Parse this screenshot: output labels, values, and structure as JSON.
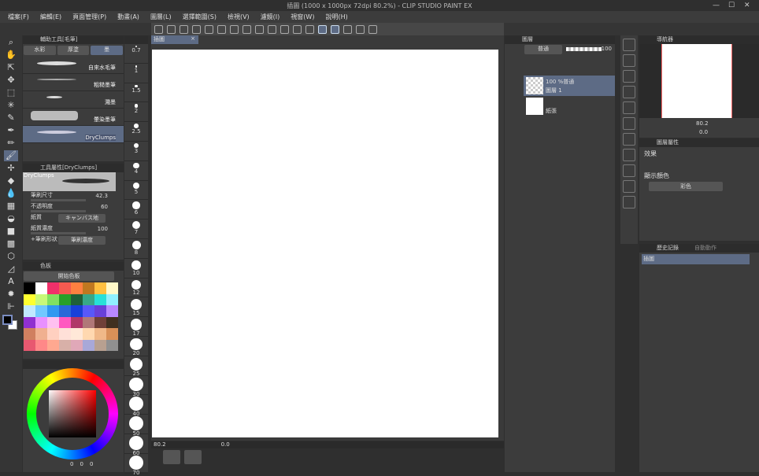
{
  "window": {
    "title": "插圖 (1000 x 1000px 72dpi 80.2%) - CLIP STUDIO PAINT EX",
    "minimize": "—",
    "maximize": "☐",
    "close": "✕"
  },
  "menu": [
    "檔案(F)",
    "編輯(E)",
    "頁面管理(P)",
    "動畫(A)",
    "圖層(L)",
    "選擇範圍(S)",
    "檢視(V)",
    "濾鏡(I)",
    "視窗(W)",
    "說明(H)"
  ],
  "subtool": {
    "title": "輔助工具[毛筆]",
    "tabs": [
      "水彩",
      "厚塗",
      "墨"
    ],
    "brushes": [
      "自來水毛筆",
      "粗糙墨筆",
      "濺墨",
      "暈染墨筆",
      "DryClumps"
    ]
  },
  "tool_property": {
    "title": "工具屬性[DryClumps]",
    "preview_label": "DryClumps",
    "brush_size_label": "筆刷尺寸",
    "brush_size": "42.3",
    "opacity_label": "不透明度",
    "opacity": "60",
    "paper_label": "紙質",
    "paper_value": "キャンバス地",
    "paper_density_label": "紙質濃度",
    "paper_density": "100",
    "extra_label": "+筆刷形狀",
    "extra_value": "筆刷濃度"
  },
  "brush_sizes": [
    "0.7",
    "1",
    "1.5",
    "2",
    "2.5",
    "3",
    "4",
    "5",
    "6",
    "7",
    "8",
    "10",
    "12",
    "15",
    "17",
    "20",
    "25",
    "30",
    "40",
    "50",
    "60",
    "70"
  ],
  "color_set": {
    "title": "色板",
    "selected": "開始色板",
    "colors": [
      "#000000",
      "#ffffff",
      "#f0306a",
      "#f55a50",
      "#ff8040",
      "#c07820",
      "#ffc040",
      "#fff8c8",
      "#ffff30",
      "#c8f878",
      "#80e060",
      "#28a028",
      "#206038",
      "#38a888",
      "#28e0d8",
      "#90f0ff",
      "#c0e8ff",
      "#70c8ff",
      "#3098f0",
      "#2868d8",
      "#1840d8",
      "#5858f8",
      "#6840d8",
      "#b888ff",
      "#9030d0",
      "#e890ff",
      "#ffc0f0",
      "#ff58c0",
      "#b03868",
      "#b07878",
      "#704038",
      "#403020",
      "#d08060",
      "#f0b090",
      "#ffd0c0",
      "#ffe0d8",
      "#ffe8d8",
      "#ffd8b0",
      "#f0b888",
      "#d89058",
      "#e85870",
      "#ff8888",
      "#ffa890",
      "#d8b0a8",
      "#e0a8b8",
      "#a8a8d8",
      "#b8a090",
      "#909090"
    ]
  },
  "color_wheel": {
    "h": "0",
    "s": "0",
    "v": "0"
  },
  "canvas": {
    "tab": "插圖",
    "zoom": "80.2",
    "rotation": "0.0"
  },
  "layers": {
    "title": "圖層",
    "blend": "普通",
    "opacity": "100",
    "items": [
      {
        "mode": "100 %普通",
        "name": "圖層 1"
      },
      {
        "mode": "",
        "name": "紙張"
      }
    ]
  },
  "navigator": {
    "title": "導航器",
    "zoom": "80.2",
    "rotation": "0.0"
  },
  "layer_property": {
    "title": "圖層屬性",
    "effect_label": "效果",
    "display_color_label": "顯示顏色",
    "display_color": "彩色"
  },
  "history": {
    "title": "歷史記錄",
    "tab2": "自動動作",
    "items": [
      "插圖"
    ]
  }
}
